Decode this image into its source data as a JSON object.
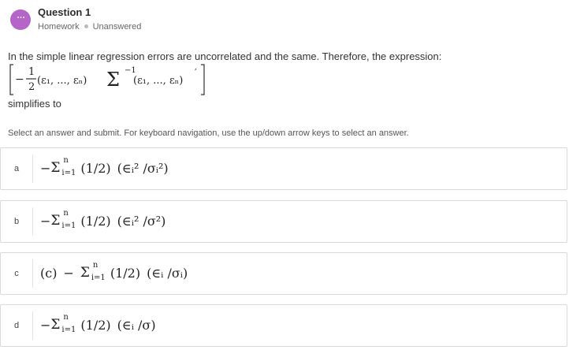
{
  "header": {
    "avatar_glyph": "···",
    "title": "Question 1",
    "category": "Homework",
    "status": "Unanswered"
  },
  "question": {
    "text": "In the simple linear regression errors are uncorrelated and the same. Therefore, the expression:",
    "formula": {
      "numerator": "1",
      "denominator": "2",
      "minus": "−",
      "left_vector": "(ε₁, ..., εₙ)",
      "sigma_symbol": "Σ",
      "inverse_exp": "−1",
      "right_vector": "(ε₁, ..., εₙ)",
      "transpose": "′"
    },
    "followup": "simplifies to"
  },
  "instructions": "Select an answer and submit. For keyboard navigation, use the up/down arrow keys to select an answer.",
  "options": [
    {
      "letter": "a",
      "prefix": "",
      "minus": "−",
      "sum_upper": "n",
      "sum_lower": "i=1",
      "coef": "(1/2)",
      "term": "(∈ᵢ² /σᵢ²)"
    },
    {
      "letter": "b",
      "prefix": "",
      "minus": "−",
      "sum_upper": "n",
      "sum_lower": "i=1",
      "coef": "(1/2)",
      "term": "(∈ᵢ² /σ²)"
    },
    {
      "letter": "c",
      "prefix": "(c)",
      "minus": "−",
      "sum_upper": "n",
      "sum_lower": "i=1",
      "coef": "(1/2)",
      "term": "(∈ᵢ /σᵢ)"
    },
    {
      "letter": "d",
      "prefix": "",
      "minus": "−",
      "sum_upper": "n",
      "sum_lower": "i=1",
      "coef": "(1/2)",
      "term": "(∈ᵢ /σ)"
    }
  ],
  "colors": {
    "avatar": "#b564c8",
    "border": "#d9d9d9",
    "text": "#333333"
  }
}
